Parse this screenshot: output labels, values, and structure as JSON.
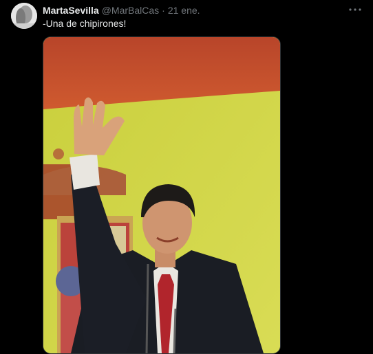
{
  "tweet": {
    "author_name": "MartaSevilla",
    "handle": "@MarBalCas",
    "separator": "·",
    "time": "21 ene.",
    "text": "-Una de chipirones!",
    "more_icon": "more-horizontal-icon"
  },
  "media": {
    "alt": "photo",
    "colors": {
      "flag_red": "#c24a2a",
      "flag_yellow": "#d6d84a",
      "suit": "#1a1d24",
      "tie": "#b1252c",
      "shirt": "#e9e6e0"
    }
  }
}
